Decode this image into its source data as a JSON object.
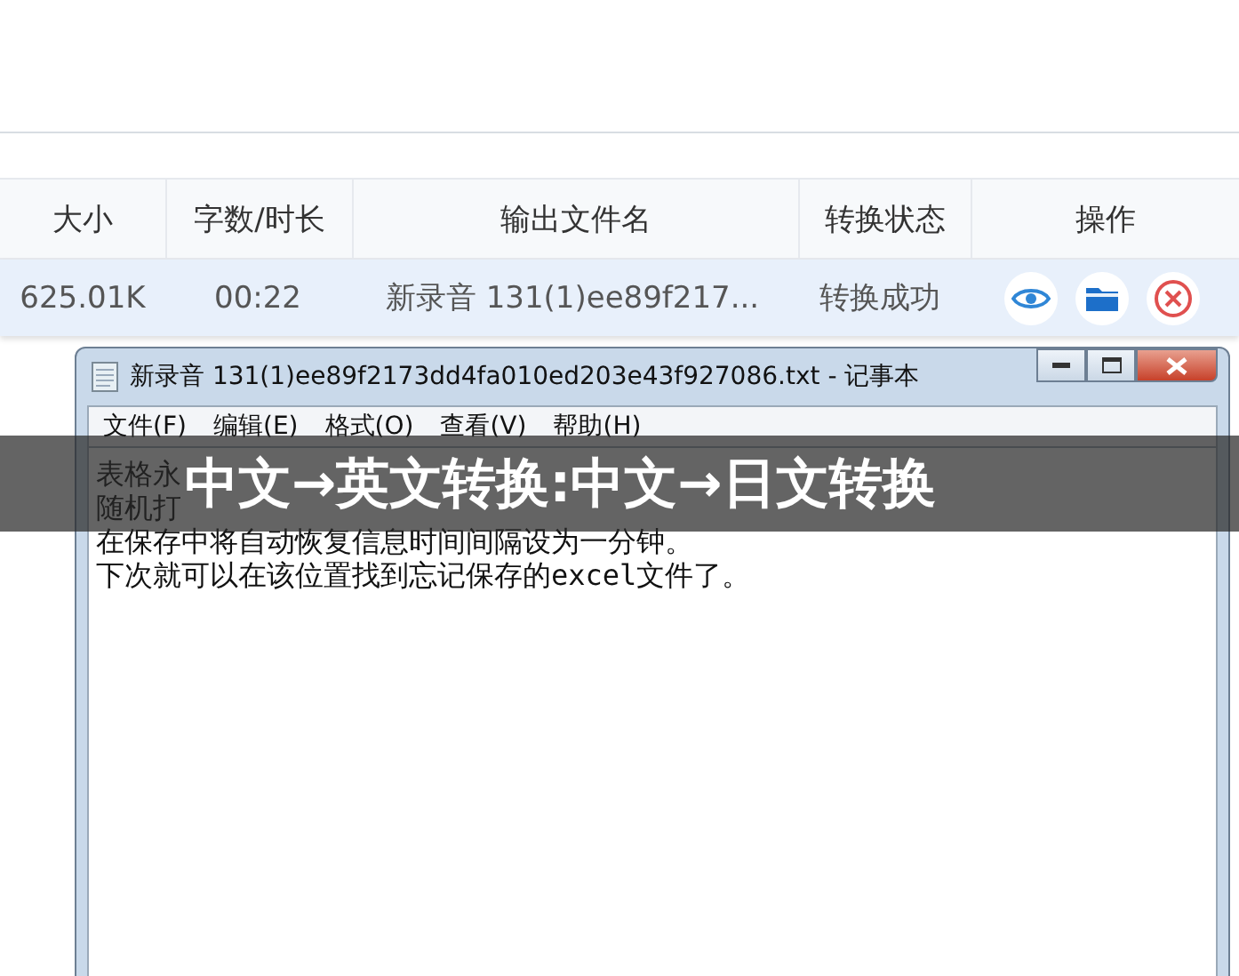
{
  "table": {
    "columns": [
      "大小",
      "字数/时长",
      "输出文件名",
      "转换状态",
      "操作"
    ],
    "rows": [
      {
        "size": "625.01K",
        "duration": "00:22",
        "output_file": "新录音 131(1)ee89f217...",
        "status": "转换成功",
        "selected": true
      }
    ]
  },
  "notepad": {
    "title": "新录音 131(1)ee89f2173dd4fa010ed203e43f927086.txt - 记事本",
    "menu": [
      "文件(F)",
      "编辑(E)",
      "格式(O)",
      "查看(V)",
      "帮助(H)"
    ],
    "lines": [
      "表格永",
      "随机打",
      "在保存中将自动恢复信息时间间隔设为一分钟。",
      "下次就可以在该位置找到忘记保存的excel文件了。"
    ]
  },
  "banner": {
    "text": "中文→英文转换:中文→日文转换"
  }
}
